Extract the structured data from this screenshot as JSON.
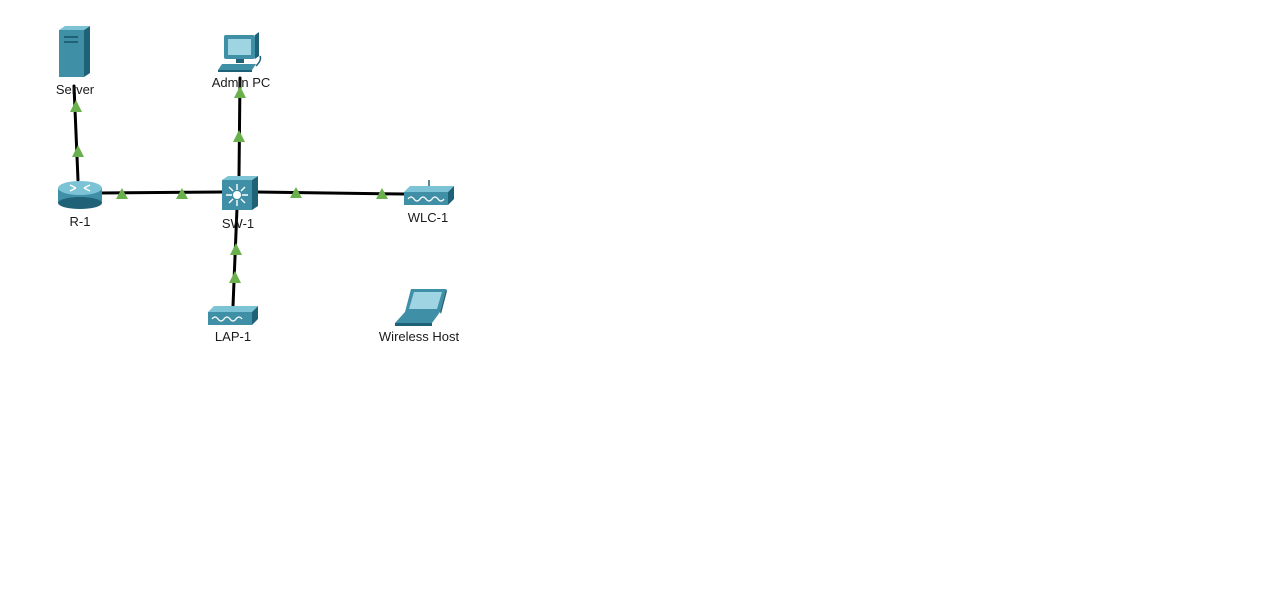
{
  "colors": {
    "link": "#000000",
    "link_up": "#6ab04c",
    "device_body": "#3f8fa6",
    "device_dark": "#1f6277",
    "device_light": "#7cc3d6",
    "label": "#1a1a1a"
  },
  "devices": [
    {
      "id": "server",
      "label": "Server",
      "icon": "server-icon"
    },
    {
      "id": "admin-pc",
      "label": "Admin PC",
      "icon": "desktop-pc-icon"
    },
    {
      "id": "r1",
      "label": "R-1",
      "icon": "router-icon"
    },
    {
      "id": "sw1",
      "label": "SW-1",
      "icon": "multilayer-switch-icon"
    },
    {
      "id": "wlc1",
      "label": "WLC-1",
      "icon": "wireless-lan-controller-icon"
    },
    {
      "id": "lap1",
      "label": "LAP-1",
      "icon": "lightweight-access-point-icon"
    },
    {
      "id": "wireless-host",
      "label": "Wireless Host",
      "icon": "laptop-icon"
    }
  ],
  "links": [
    {
      "from": "r1",
      "to": "server",
      "status": "up"
    },
    {
      "from": "r1",
      "to": "sw1",
      "status": "up"
    },
    {
      "from": "sw1",
      "to": "admin-pc",
      "status": "up"
    },
    {
      "from": "sw1",
      "to": "wlc1",
      "status": "up"
    },
    {
      "from": "sw1",
      "to": "lap1",
      "status": "up"
    }
  ]
}
